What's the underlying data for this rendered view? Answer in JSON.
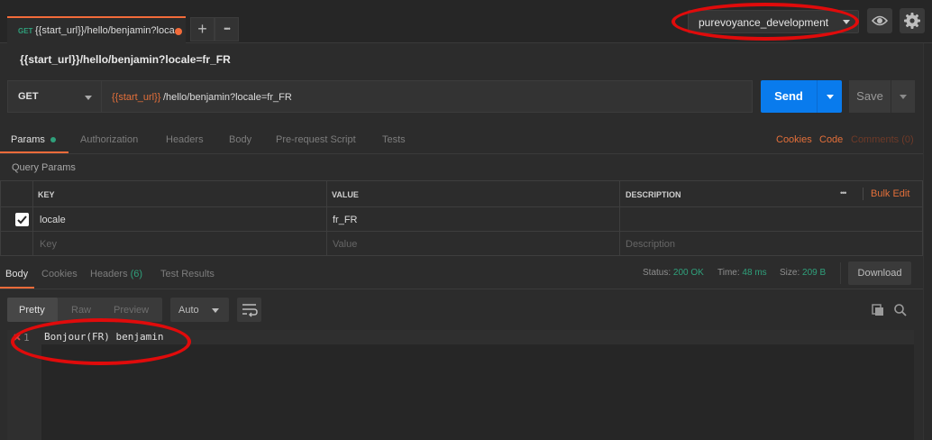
{
  "request_tab": {
    "method": "GET",
    "title": "{{start_url}}/hello/benjamin?loca",
    "add_symbol": "+",
    "more_symbol": "•••"
  },
  "environment": {
    "selected": "purevoyance_development"
  },
  "request": {
    "full_url": "{{start_url}}/hello/benjamin?locale=fr_FR",
    "method": "GET",
    "url_variable": "{{start_url}}",
    "url_rest": "/hello/benjamin?locale=fr_FR",
    "send_label": "Send",
    "save_label": "Save"
  },
  "request_tabs": {
    "params": "Params",
    "authorization": "Authorization",
    "headers": "Headers",
    "body": "Body",
    "prerequest": "Pre-request Script",
    "tests": "Tests",
    "cookies": "Cookies",
    "code": "Code",
    "comments": "Comments (0)"
  },
  "query_params": {
    "label": "Query Params",
    "headers": {
      "key": "KEY",
      "value": "VALUE",
      "description": "DESCRIPTION"
    },
    "more": "•••",
    "bulk_edit": "Bulk Edit",
    "rows": [
      {
        "key": "locale",
        "value": "fr_FR",
        "description": "",
        "checked": true
      }
    ],
    "placeholders": {
      "key": "Key",
      "value": "Value",
      "description": "Description"
    }
  },
  "response": {
    "tabs": {
      "body": "Body",
      "cookies": "Cookies",
      "headers": "Headers",
      "headers_count": "(6)",
      "test_results": "Test Results"
    },
    "status_label": "Status:",
    "status_value": "200 OK",
    "time_label": "Time:",
    "time_value": "48 ms",
    "size_label": "Size:",
    "size_value": "209 B",
    "download_label": "Download",
    "formats": {
      "pretty": "Pretty",
      "raw": "Raw",
      "preview": "Preview"
    },
    "language": "Auto",
    "line_number": "1",
    "body_text": "Bonjour(FR) benjamin"
  },
  "colors": {
    "accent": "#f26b3a",
    "send": "#097bed",
    "success": "#2fa07b",
    "annotation": "#e00b0b"
  }
}
